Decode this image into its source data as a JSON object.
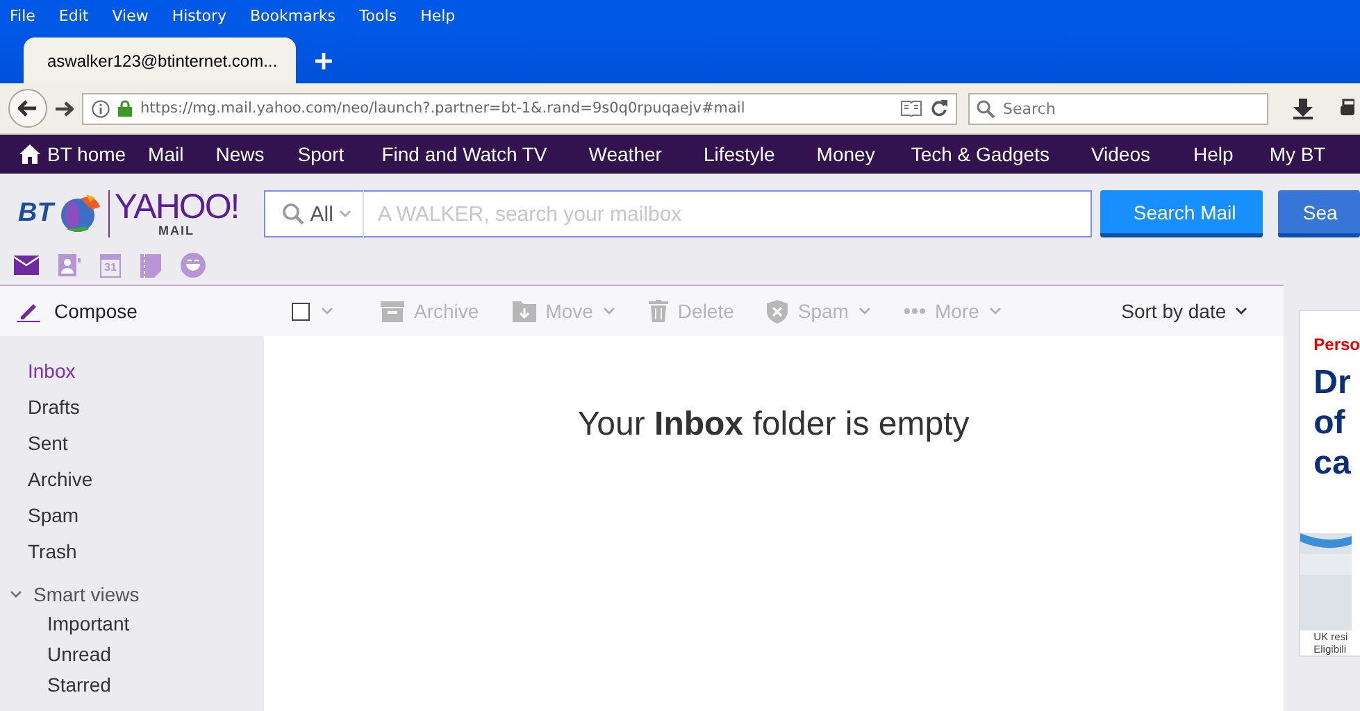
{
  "browser": {
    "menu": [
      "File",
      "Edit",
      "View",
      "History",
      "Bookmarks",
      "Tools",
      "Help"
    ],
    "tabs": [
      {
        "title": "aswalker123@btinternet.com...",
        "selected": true
      }
    ],
    "url": "https://mg.mail.yahoo.com/neo/launch?.partner=bt-1&.rand=9s0q0rpuqaejv#mail",
    "search": {
      "placeholder": "Search"
    }
  },
  "site_nav": [
    "BT home",
    "Mail",
    "News",
    "Sport",
    "Find and Watch TV",
    "Weather",
    "Lifestyle",
    "Money",
    "Tech & Gadgets",
    "Videos",
    "Help",
    "My BT"
  ],
  "mail": {
    "logo": {
      "bt": "BT",
      "brand": "YAHOO!",
      "sub": "MAIL"
    },
    "search": {
      "scope": "All",
      "placeholder": "A WALKER, search your mailbox"
    },
    "search_buttons": [
      "Search Mail",
      "Sea"
    ],
    "apps": [
      {
        "kind": "mail",
        "selected": true
      },
      {
        "kind": "contacts",
        "selected": false
      },
      {
        "kind": "calendar",
        "label": "31",
        "selected": false
      },
      {
        "kind": "notepad",
        "selected": false
      },
      {
        "kind": "messenger",
        "selected": false
      }
    ],
    "compose": "Compose",
    "select_all": {
      "checked": false
    },
    "actions": [
      {
        "kind": "archive",
        "label": "Archive",
        "dropdown": false,
        "disabled": true
      },
      {
        "kind": "move",
        "label": "Move",
        "dropdown": true,
        "disabled": true
      },
      {
        "kind": "delete",
        "label": "Delete",
        "dropdown": false,
        "disabled": true
      },
      {
        "kind": "spam",
        "label": "Spam",
        "dropdown": true,
        "disabled": true
      },
      {
        "kind": "more",
        "label": "More",
        "dropdown": true,
        "disabled": true
      }
    ],
    "sort": "Sort by date",
    "folders": [
      {
        "label": "Inbox",
        "selected": true
      },
      {
        "label": "Drafts",
        "selected": false
      },
      {
        "label": "Sent",
        "selected": false
      },
      {
        "label": "Archive",
        "selected": false
      },
      {
        "label": "Spam",
        "selected": false
      },
      {
        "label": "Trash",
        "selected": false
      }
    ],
    "smart_views": {
      "label": "Smart views",
      "expanded": true,
      "children": [
        {
          "label": "Important",
          "selected": false
        },
        {
          "label": "Unread",
          "selected": false
        },
        {
          "label": "Starred",
          "selected": false
        }
      ]
    },
    "empty_message": "Your **Inbox** folder is empty",
    "ad": {
      "tag": "Perso",
      "headline": [
        "Dr",
        "of",
        "ca"
      ],
      "footnote": [
        "UK resi",
        "Eligibili"
      ]
    }
  }
}
